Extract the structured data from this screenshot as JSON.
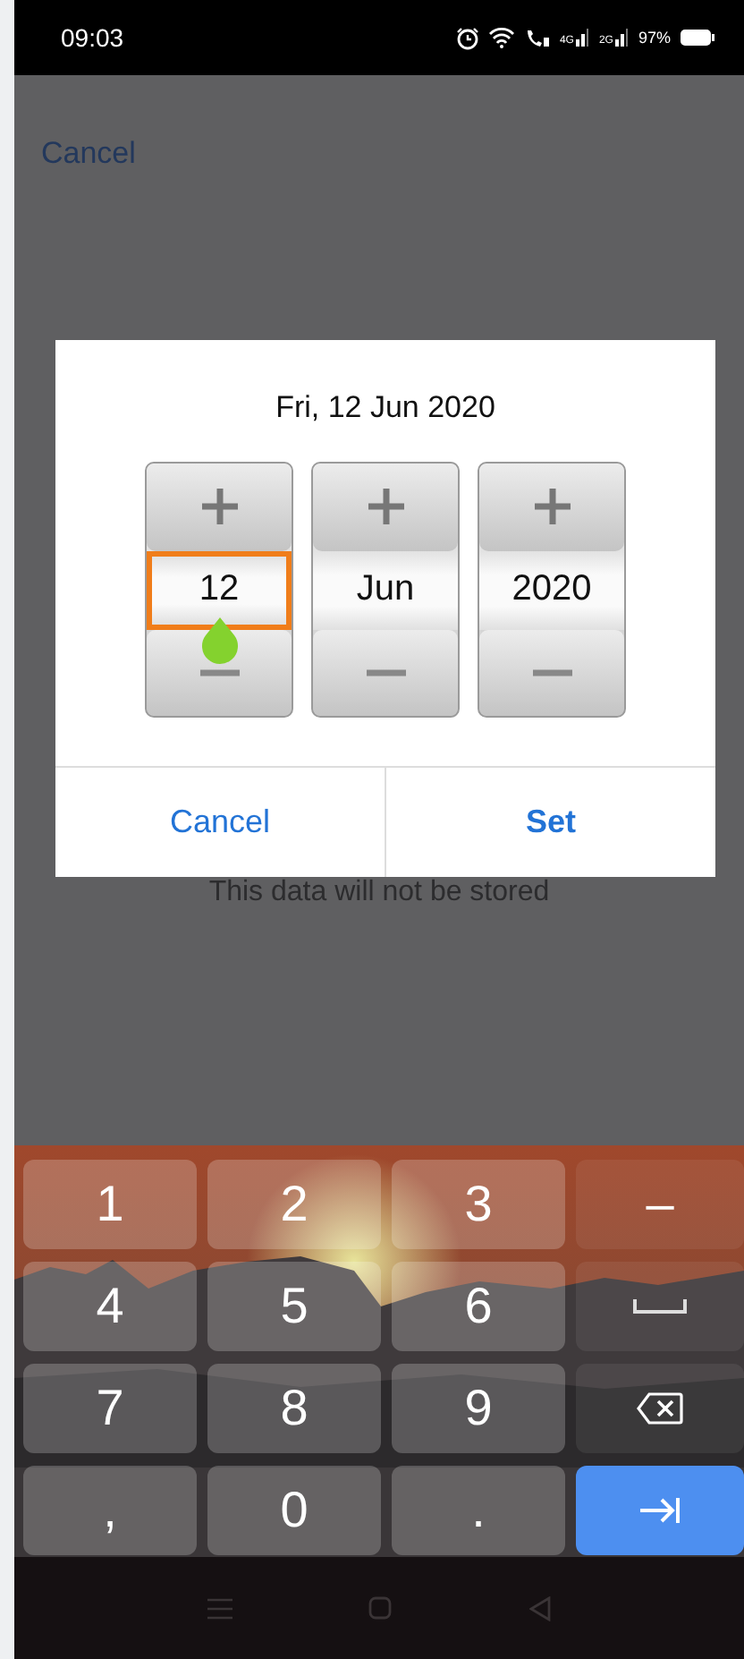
{
  "status_bar": {
    "time": "09:03",
    "networks": [
      "4G",
      "2G"
    ],
    "battery": "97%"
  },
  "page": {
    "cancel": "Cancel",
    "note": "This data will not be stored"
  },
  "dialog": {
    "title": "Fri, 12 Jun 2020",
    "spinners": [
      {
        "value": "12",
        "focused": true
      },
      {
        "value": "Jun",
        "focused": false
      },
      {
        "value": "2020",
        "focused": false
      }
    ],
    "buttons": [
      {
        "label": "Cancel",
        "bold": false
      },
      {
        "label": "Set",
        "bold": true
      }
    ]
  },
  "keyboard": {
    "keys": [
      {
        "kind": "char",
        "label": "1"
      },
      {
        "kind": "char",
        "label": "2"
      },
      {
        "kind": "char",
        "label": "3"
      },
      {
        "kind": "char",
        "label": "–"
      },
      {
        "kind": "char",
        "label": "4"
      },
      {
        "kind": "char",
        "label": "5"
      },
      {
        "kind": "char",
        "label": "6"
      },
      {
        "kind": "space"
      },
      {
        "kind": "char",
        "label": "7"
      },
      {
        "kind": "char",
        "label": "8"
      },
      {
        "kind": "char",
        "label": "9"
      },
      {
        "kind": "backspace"
      },
      {
        "kind": "char",
        "label": ","
      },
      {
        "kind": "char",
        "label": "0"
      },
      {
        "kind": "char",
        "label": "."
      },
      {
        "kind": "next"
      }
    ]
  }
}
